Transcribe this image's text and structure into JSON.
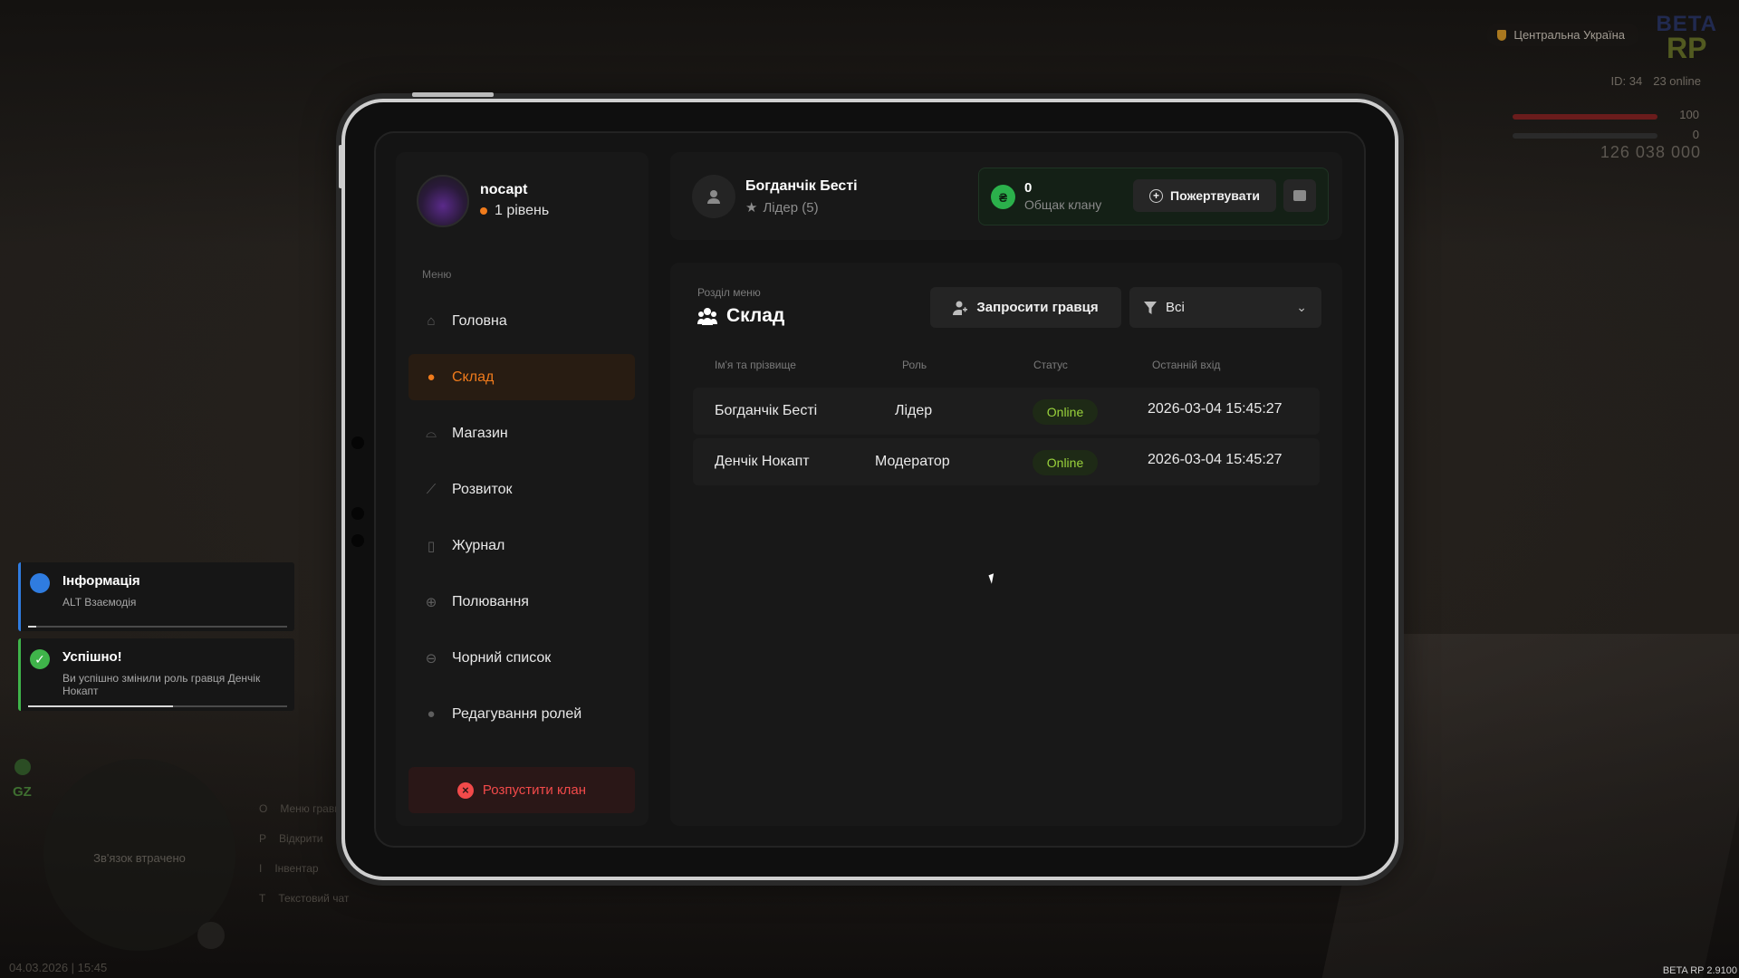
{
  "hud": {
    "region": "Центральна Україна",
    "logo_line1": "BETA",
    "logo_line2": "RP",
    "player_id": "ID: 34",
    "online": "23 online",
    "health": "100",
    "armor": "0",
    "money": "126 038 000",
    "datetime": "04.03.2026 | 15:45",
    "build": "BETA RP 2.9100"
  },
  "notifications": [
    {
      "title": "Інформація",
      "text": "ALT Взаємодія",
      "icon": "lightbulb-icon",
      "color": "#2f7ce0",
      "progress": 0.03
    },
    {
      "title": "Успішно!",
      "text": "Ви успішно змінили роль гравця Денчік Нокапт",
      "icon": "check-icon",
      "color": "#3fb44a",
      "progress": 0.56
    }
  ],
  "hotkeys": [
    {
      "key": "O",
      "label": "Меню гравця"
    },
    {
      "key": "P",
      "label": "Відкрити"
    },
    {
      "key": "I",
      "label": "Інвентар"
    },
    {
      "key": "T",
      "label": "Текстовий чат"
    }
  ],
  "radar": {
    "status": "Зв'язок втрачено",
    "zone": "GZ"
  },
  "profile": {
    "name": "nocapt",
    "level": "1 рівень"
  },
  "menu": {
    "caption": "Меню",
    "items": [
      {
        "label": "Головна",
        "icon": "home-icon",
        "glyph": "⌂"
      },
      {
        "label": "Склад",
        "icon": "team-icon",
        "glyph": "●"
      },
      {
        "label": "Магазин",
        "icon": "basket-icon",
        "glyph": "⌓"
      },
      {
        "label": "Розвиток",
        "icon": "chart-line-icon",
        "glyph": "⟋"
      },
      {
        "label": "Журнал",
        "icon": "book-icon",
        "glyph": "▯"
      },
      {
        "label": "Полювання",
        "icon": "crosshair-icon",
        "glyph": "⊕"
      },
      {
        "label": "Чорний список",
        "icon": "ban-icon",
        "glyph": "⊖"
      },
      {
        "label": "Редагування ролей",
        "icon": "user-edit-icon",
        "glyph": "●"
      }
    ],
    "active_index": 1,
    "disband_label": "Розпустити клан"
  },
  "leader": {
    "name": "Богданчік Бесті",
    "role": "Лідер (5)"
  },
  "bank": {
    "value": "0",
    "label": "Общак клану",
    "currency_glyph": "₴",
    "donate_label": "Пожертвувати"
  },
  "section": {
    "caption": "Розділ меню",
    "title": "Склад",
    "invite_label": "Запросити гравця",
    "filter_value": "Всі"
  },
  "table": {
    "headers": [
      "Ім'я та прізвище",
      "Роль",
      "Статус",
      "Останній вхід"
    ],
    "rows": [
      {
        "name": "Богданчік Бесті",
        "role": "Лідер",
        "status": "Online",
        "last_login": "2026-03-04 15:45:27"
      },
      {
        "name": "Денчік Нокапт",
        "role": "Модератор",
        "status": "Online",
        "last_login": "2026-03-04 15:45:27"
      }
    ]
  },
  "colors": {
    "accent": "#f07b1c",
    "online": "#9ad33c",
    "danger": "#f24a4a",
    "bank": "#2bb04b"
  }
}
